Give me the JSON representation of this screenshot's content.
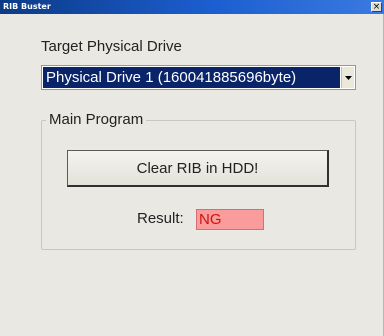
{
  "window": {
    "title": "RIB Buster",
    "close_glyph": "×"
  },
  "drive": {
    "label": "Target Physical Drive",
    "selected": "Physical Drive 1 (160041885696byte)"
  },
  "group": {
    "legend": "Main Program",
    "clear_button_label": "Clear RIB in HDD!",
    "result_label": "Result:",
    "result_value": "NG",
    "result_color": "#fb9c9c",
    "result_text_color": "#d01010"
  }
}
